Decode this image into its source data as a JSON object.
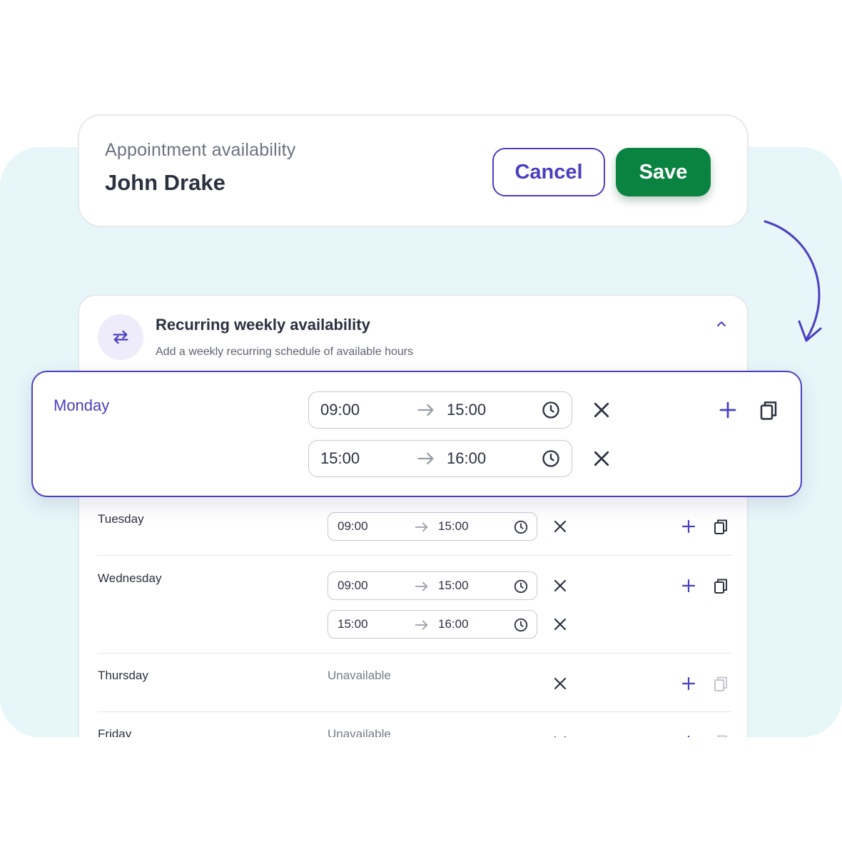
{
  "header": {
    "subtitle": "Appointment availability",
    "name": "John Drake",
    "cancel_label": "Cancel",
    "save_label": "Save"
  },
  "section": {
    "title": "Recurring weekly availability",
    "description": "Add a weekly recurring schedule of available hours",
    "icon": "repeat-icon"
  },
  "days": {
    "monday": {
      "label": "Monday",
      "slots": [
        {
          "start": "09:00",
          "end": "15:00"
        },
        {
          "start": "15:00",
          "end": "16:00"
        }
      ]
    },
    "tuesday": {
      "label": "Tuesday",
      "slots": [
        {
          "start": "09:00",
          "end": "15:00"
        }
      ]
    },
    "wednesday": {
      "label": "Wednesday",
      "slots": [
        {
          "start": "09:00",
          "end": "15:00"
        },
        {
          "start": "15:00",
          "end": "16:00"
        }
      ]
    },
    "thursday": {
      "label": "Thursday",
      "status": "Unavailable"
    },
    "friday": {
      "label": "Friday",
      "status": "Unavailable"
    }
  },
  "colors": {
    "accent": "#4a3fc0",
    "save": "#0a8341",
    "background_panel": "#e6f6f9",
    "text": "#2c3140"
  }
}
